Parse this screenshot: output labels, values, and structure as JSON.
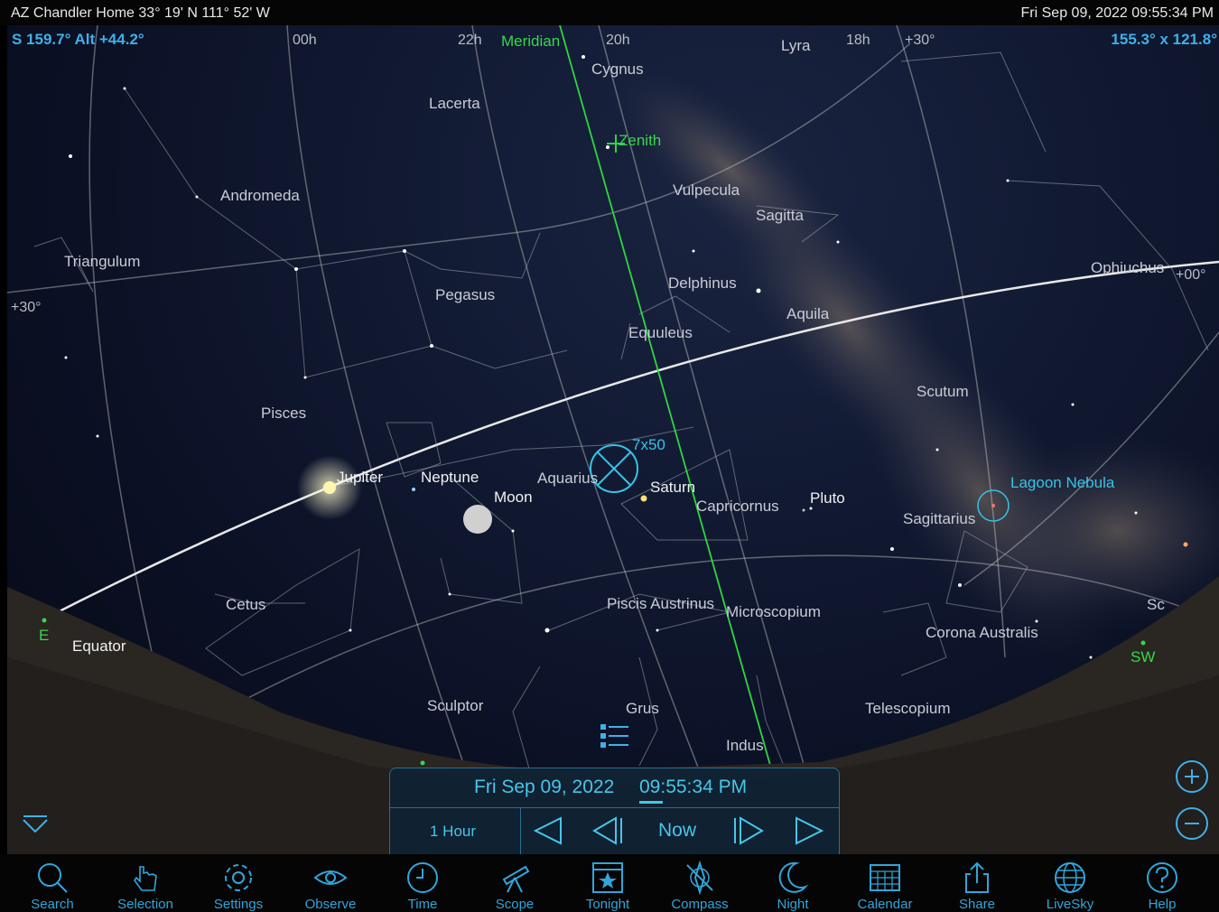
{
  "status": {
    "location": "AZ Chandler Home  33° 19' N 111° 52' W",
    "datetime": "Fri Sep 09, 2022  09:55:34 PM"
  },
  "hud": {
    "pointing": "S 159.7° Alt +44.2°",
    "fov": "155.3° x 121.8°"
  },
  "grid_labels": {
    "ra_00h": "00h",
    "ra_22h": "22h",
    "ra_20h": "20h",
    "ra_18h": "18h",
    "dec_30_left": "+30°",
    "dec_30_top": "+30°",
    "dec_00": "+00°"
  },
  "lines": {
    "meridian": "Meridian",
    "zenith": "Zenith"
  },
  "constellations": [
    "Cygnus",
    "Lyra",
    "Lacerta",
    "Andromeda",
    "Triangulum",
    "Pegasus",
    "Vulpecula",
    "Sagitta",
    "Delphinus",
    "Aquila",
    "Equuleus",
    "Ophiuchus",
    "Scutum",
    "Pisces",
    "Aquarius",
    "Capricornus",
    "Sagittarius",
    "Cetus",
    "Piscis Austrinus",
    "Microscopium",
    "Corona Australis",
    "Sculptor",
    "Grus",
    "Telescopium",
    "Indus",
    "Equator",
    "Sc"
  ],
  "objects": {
    "jupiter": "Jupiter",
    "neptune": "Neptune",
    "moon": "Moon",
    "saturn": "Saturn",
    "pluto": "Pluto",
    "lagoon": "Lagoon Nebula",
    "eyepiece": "7x50"
  },
  "compass": {
    "east": "E",
    "southwest": "SW"
  },
  "time_panel": {
    "date": "Fri Sep 09, 2022",
    "time": "09:55:34 PM",
    "step": "1 Hour",
    "now": "Now"
  },
  "toolbar": [
    "Search",
    "Selection",
    "Settings",
    "Observe",
    "Time",
    "Scope",
    "Tonight",
    "Compass",
    "Night",
    "Calendar",
    "Share",
    "LiveSky",
    "Help"
  ],
  "colors": {
    "accent": "#3fb0e8",
    "green": "#35d84a",
    "cyan": "#37c3e6"
  }
}
